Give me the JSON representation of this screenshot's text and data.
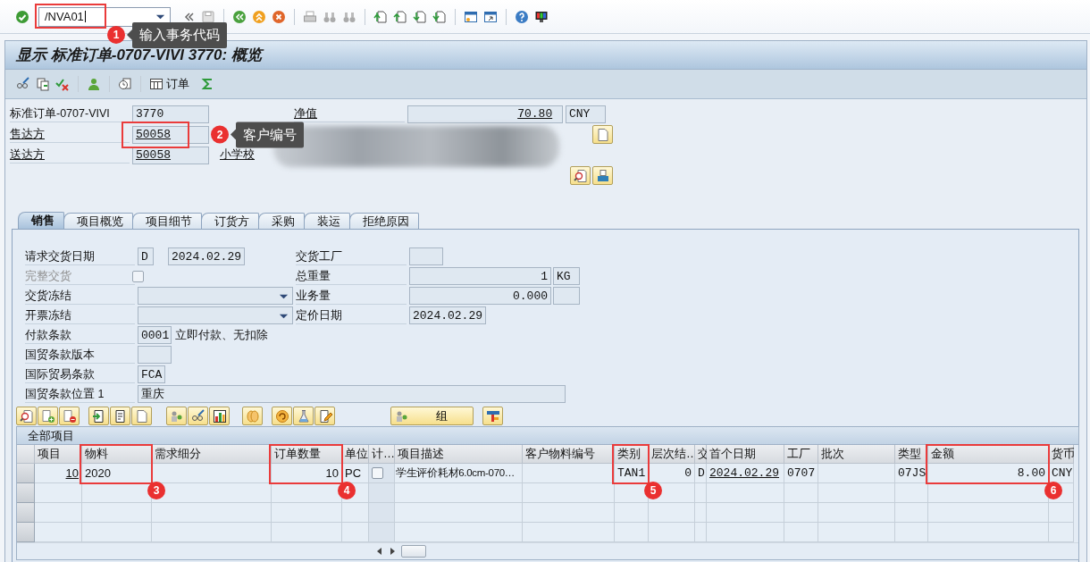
{
  "command": {
    "value": "/NVA01",
    "marker": {
      "number": "1",
      "tip": "输入事务代码"
    }
  },
  "title": "显示 标准订单-0707-VIVI 3770: 概览",
  "app_toolbar": {
    "order_button": "订单"
  },
  "header": {
    "order_type_label": "标准订单-0707-VIVI",
    "order_number": "3770",
    "net_value_label": "净值",
    "net_value": "70.80",
    "currency": "CNY",
    "sold_to": {
      "label": "售达方",
      "value": "50058",
      "marker": {
        "number": "2",
        "tip": "客户编号"
      }
    },
    "ship_to": {
      "label": "送达方",
      "value": "50058",
      "name": "小学校"
    }
  },
  "tabs": [
    {
      "label": "销售",
      "selected": true
    },
    {
      "label": "项目概览",
      "selected": false
    },
    {
      "label": "项目细节",
      "selected": false
    },
    {
      "label": "订货方",
      "selected": false
    },
    {
      "label": "采购",
      "selected": false
    },
    {
      "label": "装运",
      "selected": false
    },
    {
      "label": "拒绝原因",
      "selected": false
    }
  ],
  "sales_left": [
    {
      "label": "请求交货日期",
      "kind": "date",
      "code": "D",
      "value": "2024.02.29"
    },
    {
      "label": "完整交货",
      "kind": "checkbox",
      "disabled": true,
      "checked": false
    },
    {
      "label": "交货冻结",
      "kind": "dropdown"
    },
    {
      "label": "开票冻结",
      "kind": "dropdown"
    },
    {
      "label": "付款条款",
      "kind": "code",
      "value": "0001",
      "note": "立即付款、无扣除"
    },
    {
      "label": "国贸条款版本",
      "kind": "code"
    },
    {
      "label": "国际贸易条款",
      "kind": "short",
      "value": "FCA"
    },
    {
      "label": "国贸条款位置 1",
      "kind": "long",
      "value": "重庆"
    }
  ],
  "sales_right": [
    {
      "label": "交货工厂",
      "kind": "code"
    },
    {
      "label": "总重量",
      "kind": "quantity",
      "value": "1",
      "unit": "KG"
    },
    {
      "label": "业务量",
      "kind": "quantity",
      "value": "0.000"
    },
    {
      "label": "定价日期",
      "kind": "date",
      "value": "2024.02.29"
    }
  ],
  "group_button": "组",
  "items_table": {
    "title": "全部项目",
    "columns": [
      {
        "label": "项目"
      },
      {
        "label": "物料",
        "marker": {
          "number": "3"
        }
      },
      {
        "label": "需求细分"
      },
      {
        "label": "订单数量",
        "marker": {
          "number": "4"
        }
      },
      {
        "label": "单位"
      },
      {
        "label": "计…"
      },
      {
        "label": "项目描述"
      },
      {
        "label": "客户物料编号"
      },
      {
        "label": "类别",
        "marker": {
          "number": "5"
        }
      },
      {
        "label": "层次结…"
      },
      {
        "label": "交"
      },
      {
        "label": "首个日期"
      },
      {
        "label": "工厂"
      },
      {
        "label": "批次"
      },
      {
        "label": "类型"
      },
      {
        "label": "金额",
        "marker": {
          "number": "6"
        }
      },
      {
        "label": "货币"
      }
    ],
    "rows": [
      {
        "cells": [
          "10",
          "2020",
          null,
          "10",
          "PC",
          {
            "kind": "checkbox",
            "checked": false
          },
          "学生评价耗材6.0cm-070…",
          null,
          "TAN1",
          "0",
          "D",
          "2024.02.29",
          "0707",
          null,
          "07JS",
          "8.00",
          "CNY"
        ]
      }
    ]
  }
}
